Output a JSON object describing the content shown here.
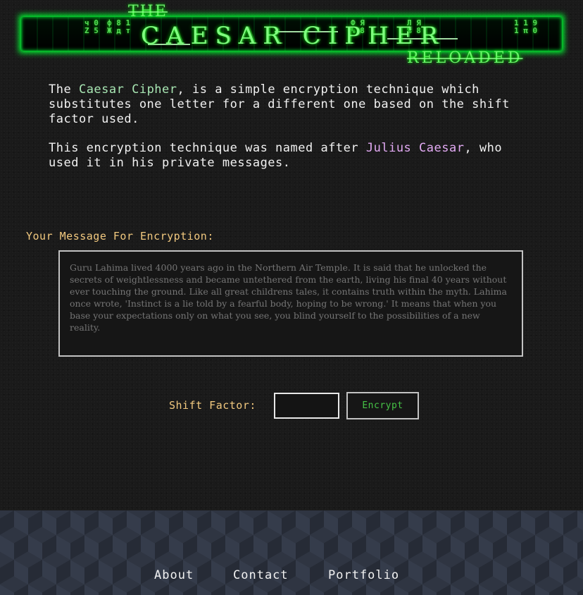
{
  "header": {
    "the": "THE",
    "title": "CAESAR CIPHER",
    "subtitle": "RELOADED"
  },
  "intro": {
    "p1_before": "The ",
    "p1_highlight": "Caesar Cipher",
    "p1_after": ", is a simple encryption technique which substitutes one letter for a different one based on the shift factor used.",
    "p2_before": "This encryption technique was named after ",
    "p2_highlight": "Julius Caesar",
    "p2_after": ", who used it in his private messages."
  },
  "form": {
    "message_label": "Your Message For Encryption:",
    "message_placeholder": "Guru Lahima lived 4000 years ago in the Northern Air Temple. It is said that he unlocked the secrets of weightlessness and became untethered from the earth, living his final 40 years without ever touching the ground. Like all great childrens tales, it contains truth within the myth. Lahima once wrote, 'Instinct is a lie told by a fearful body, hoping to be wrong.' It means that when you base your expectations only on what you see, you blind yourself to the possibilities of a new reality.",
    "shift_label": "Shift Factor:",
    "shift_value": "",
    "encrypt_label": "Encrypt"
  },
  "footer": {
    "links": [
      "About",
      "Contact",
      "Portfolio"
    ]
  },
  "colors": {
    "accent_green": "#a8e6b3",
    "accent_pink": "#e2aaf3",
    "label_gold": "#f2c97f",
    "matrix_green": "#00ff33"
  }
}
